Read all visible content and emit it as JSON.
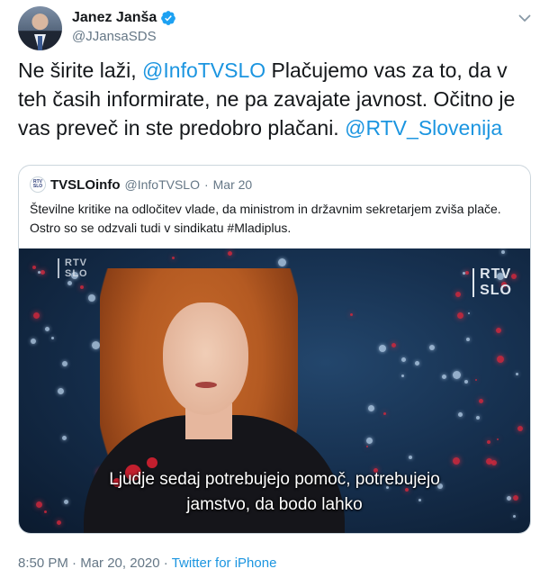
{
  "author": {
    "display_name": "Janez Janša",
    "handle": "@JJansaSDS",
    "icon": "verified-badge-icon"
  },
  "tweet": {
    "parts": [
      {
        "text": "Ne širite laži, ",
        "link": false
      },
      {
        "text": "@InfoTVSLO",
        "link": true
      },
      {
        "text": " Plačujemo vas za to, da v teh časih informirate, ne pa zavajate javnost. Očitno je vas preveč in ste predobro plačani. ",
        "link": false
      },
      {
        "text": "@RTV_Slovenija",
        "link": true
      }
    ]
  },
  "quote": {
    "avatar_text": "RTV SLO",
    "display_name": "TVSLOinfo",
    "handle": "@InfoTVSLO",
    "separator": "·",
    "date": "Mar 20",
    "text": "Številne kritike na odločitev vlade, da ministrom in državnim sekretarjem zviša plače. Ostro so se odzvali tudi v sindikatu #Mladiplus.",
    "video": {
      "logo_small": [
        "RTV",
        "SLO"
      ],
      "logo_big": [
        "RTV",
        "SLO"
      ],
      "subtitle_line1": "Ljudje sedaj potrebujejo pomoč, potrebujejo",
      "subtitle_line2": "jamstvo, da bodo lahko"
    }
  },
  "meta": {
    "time": "8:50 PM",
    "sep1": "·",
    "date": "Mar 20, 2020",
    "sep2": "·",
    "source": "Twitter for iPhone"
  },
  "colors": {
    "link": "#1b95e0",
    "secondary_text": "#657786",
    "verified": "#1da1f2"
  }
}
